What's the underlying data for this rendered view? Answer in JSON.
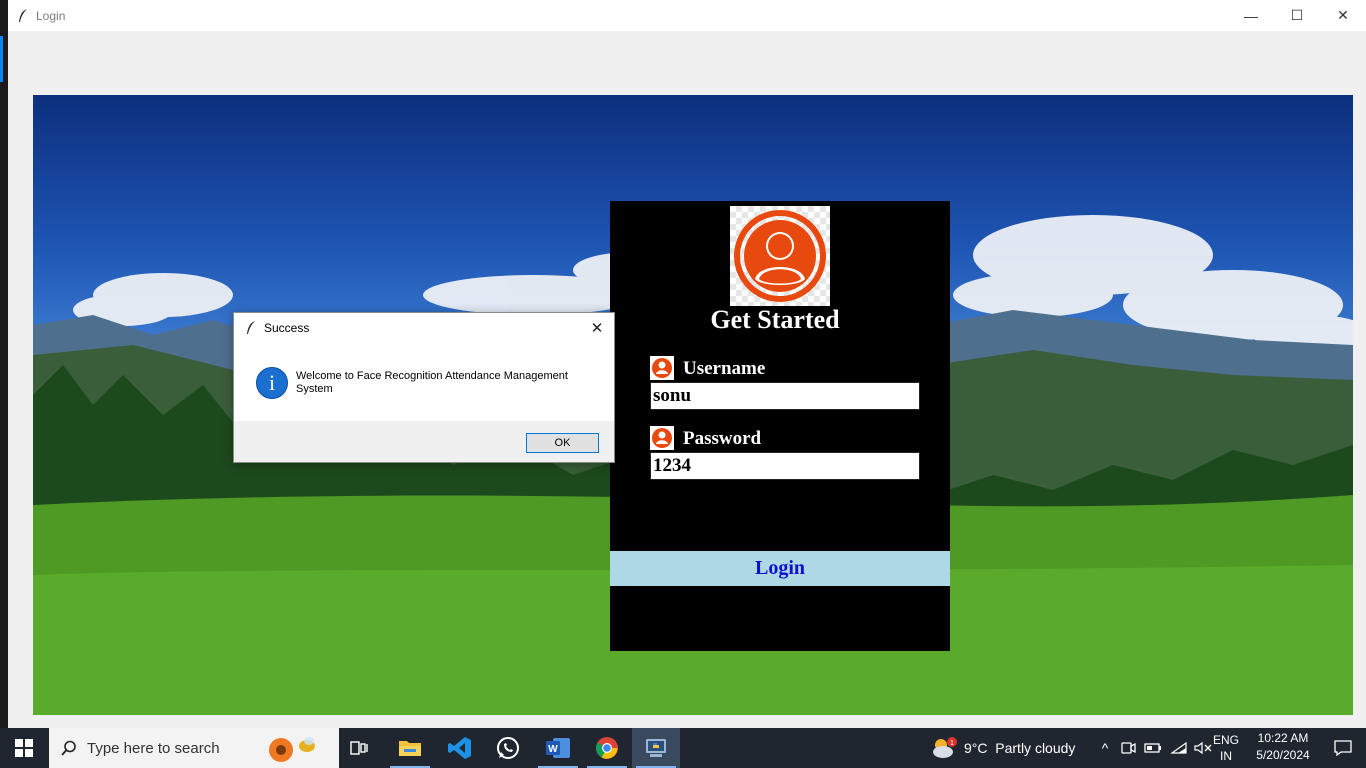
{
  "window": {
    "title": "Login",
    "controls": {
      "minimize": "—",
      "maximize": "☐",
      "close": "✕"
    }
  },
  "login_panel": {
    "title": "Get Started",
    "username_label": "Username",
    "username_value": "sonu",
    "password_label": "Password",
    "password_value": "1234",
    "login_button": "Login",
    "button_bg": "#add8e6",
    "button_text_color": "#1010d0"
  },
  "dialog": {
    "title": "Success",
    "close": "✕",
    "icon": "i",
    "message": "Welcome to Face Recognition Attendance Management System",
    "ok_button": "OK"
  },
  "taskbar": {
    "search_placeholder": "Type here to search",
    "weather": "9°C  Partly cloudy",
    "weather_badge": "1",
    "lang_line1": "ENG",
    "lang_line2": "IN",
    "time": "10:22 AM",
    "date": "5/20/2024",
    "tray_caret": "^",
    "apps": [
      "task-view",
      "file-explorer",
      "vscode",
      "whatsapp",
      "word",
      "chrome",
      "python"
    ]
  },
  "colors": {
    "avatar_orange": "#e8490f",
    "accent_blue": "#0078d7"
  }
}
